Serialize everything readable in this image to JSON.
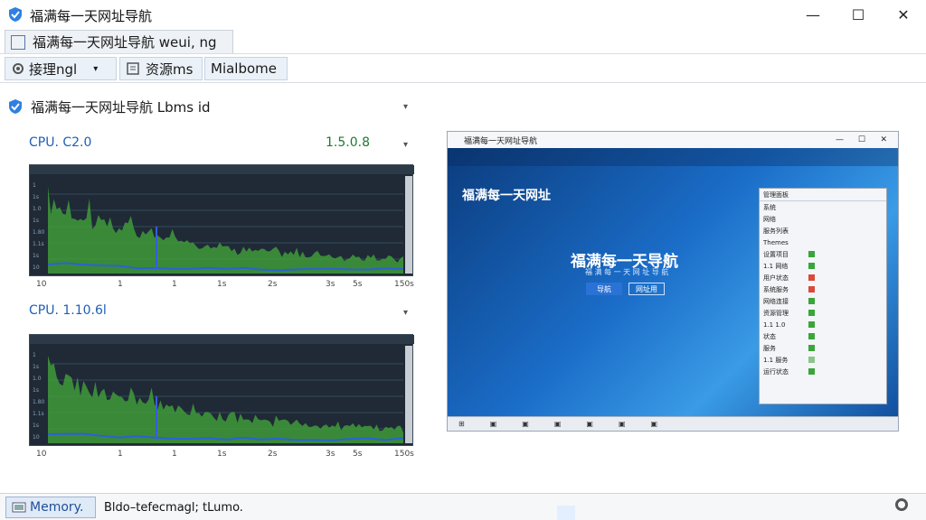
{
  "window": {
    "title": "福满每一天网址导航",
    "minimize": "—",
    "maximize": "☐",
    "close": "✕"
  },
  "tabs": {
    "main_label": "福满每一天网址导航 weui, ng"
  },
  "toolbar": {
    "items": [
      {
        "label": "接理ngl"
      },
      {
        "label": "资源ms"
      },
      {
        "label": "Mialbome"
      }
    ],
    "dropdown_caret": "▾"
  },
  "panel": {
    "header": "福满每一天网址导航 Lbms id",
    "caret": "▾",
    "graphs": [
      {
        "label": "CPU. C2.0",
        "value": "1.5.0.8",
        "axis_bottom": [
          "10",
          "1",
          "1",
          "1s",
          "2s",
          "3s",
          "5s",
          "150s"
        ],
        "axis_left": [
          "1",
          "1s",
          "1.0",
          "1s",
          "1.80",
          "1.1s",
          "1s",
          "10"
        ]
      },
      {
        "label": "CPU.  1.10.6l",
        "value": "",
        "axis_bottom": [
          "10",
          "1",
          "1",
          "1s",
          "2s",
          "3s",
          "5s",
          "150s"
        ],
        "axis_left": [
          "1",
          "1s",
          "1.0",
          "1s",
          "1.80",
          "1.1s",
          "1s",
          "10"
        ]
      }
    ],
    "colors": {
      "graph_bg": "#1f2a36",
      "fill": "#3f9a3a",
      "line": "#2a62d4"
    }
  },
  "screenshot": {
    "title": "福满每一天网址导航",
    "logo": "福满每一天网址",
    "hero": "福满每一天导航",
    "subtitle": "福 满 每 一 天 网 址 导 航",
    "btn_primary": "导航",
    "btn_secondary": "网址用",
    "panel_title": "管理面板",
    "panel_rows": [
      "系统",
      "网络",
      "服务列表",
      "Themes",
      "设置项目",
      "1.1 网络",
      "用户状态",
      "系统服务",
      "网络连接",
      "资源管理",
      "1.1 1.0",
      "状态",
      "服务",
      "1.1 服务",
      "运行状态"
    ],
    "taskbar": [
      "⊞",
      "▣",
      "▣",
      "▣",
      "▣",
      "▣",
      "▣"
    ]
  },
  "status": {
    "tab_label": "Memory.",
    "text": "Bldo–tefecmagl; tLumo."
  }
}
